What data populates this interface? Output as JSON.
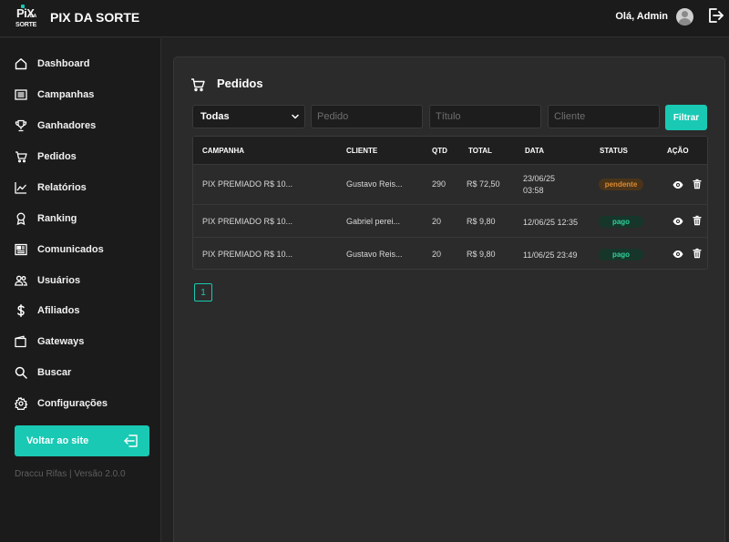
{
  "header": {
    "logo": {
      "line1": "PiX",
      "line2": "DA",
      "line3": "SORTE"
    },
    "brand": "PIX DA SORTE",
    "greeting": "Olá, Admin"
  },
  "sidebar": {
    "items": [
      {
        "label": "Dashboard",
        "icon": "home-icon"
      },
      {
        "label": "Campanhas",
        "icon": "list-icon"
      },
      {
        "label": "Ganhadores",
        "icon": "trophy-icon"
      },
      {
        "label": "Pedidos",
        "icon": "cart-icon"
      },
      {
        "label": "Relatórios",
        "icon": "chart-line-icon"
      },
      {
        "label": "Ranking",
        "icon": "medal-icon"
      },
      {
        "label": "Comunicados",
        "icon": "newspaper-icon"
      },
      {
        "label": "Usuários",
        "icon": "users-icon"
      },
      {
        "label": "Afiliados",
        "icon": "dollar-icon"
      },
      {
        "label": "Gateways",
        "icon": "wallet-icon"
      },
      {
        "label": "Buscar",
        "icon": "search-icon"
      },
      {
        "label": "Configurações",
        "icon": "gear-icon"
      }
    ],
    "back_button": "Voltar ao site",
    "version": "Draccu Rifas | Versão 2.0.0"
  },
  "main": {
    "title": "Pedidos",
    "filters": {
      "status_select": "Todas",
      "pedido_placeholder": "Pedido",
      "titulo_placeholder": "Título",
      "cliente_placeholder": "Cliente",
      "filter_button": "Filtrar"
    },
    "table": {
      "headers": {
        "campanha": "CAMPANHA",
        "cliente": "CLIENTE",
        "qtd": "QTD",
        "total": "TOTAL",
        "data": "DATA",
        "status": "STATUS",
        "acao": "AÇÃO"
      },
      "rows": [
        {
          "campanha": "PIX PREMIADO R$ 10...",
          "cliente": "Gustavo Reis...",
          "qtd": "290",
          "total": "R$ 72,50",
          "data_line1": "23/06/25",
          "data_line2": "03:58",
          "status": "pendente"
        },
        {
          "campanha": "PIX PREMIADO R$ 10...",
          "cliente": "Gabriel perei...",
          "qtd": "20",
          "total": "R$ 9,80",
          "data_line1": "12/06/25 12:35",
          "data_line2": "",
          "status": "pago"
        },
        {
          "campanha": "PIX PREMIADO R$ 10...",
          "cliente": "Gustavo Reis...",
          "qtd": "20",
          "total": "R$ 9,80",
          "data_line1": "11/06/25 23:49",
          "data_line2": "",
          "status": "pago"
        }
      ]
    },
    "pagination": {
      "current_page": "1"
    }
  },
  "colors": {
    "accent": "#19c9b4",
    "pending": "#dc8a33",
    "paid": "#2ed29a",
    "background": "#222222",
    "sidebar": "#1b1b1b"
  }
}
